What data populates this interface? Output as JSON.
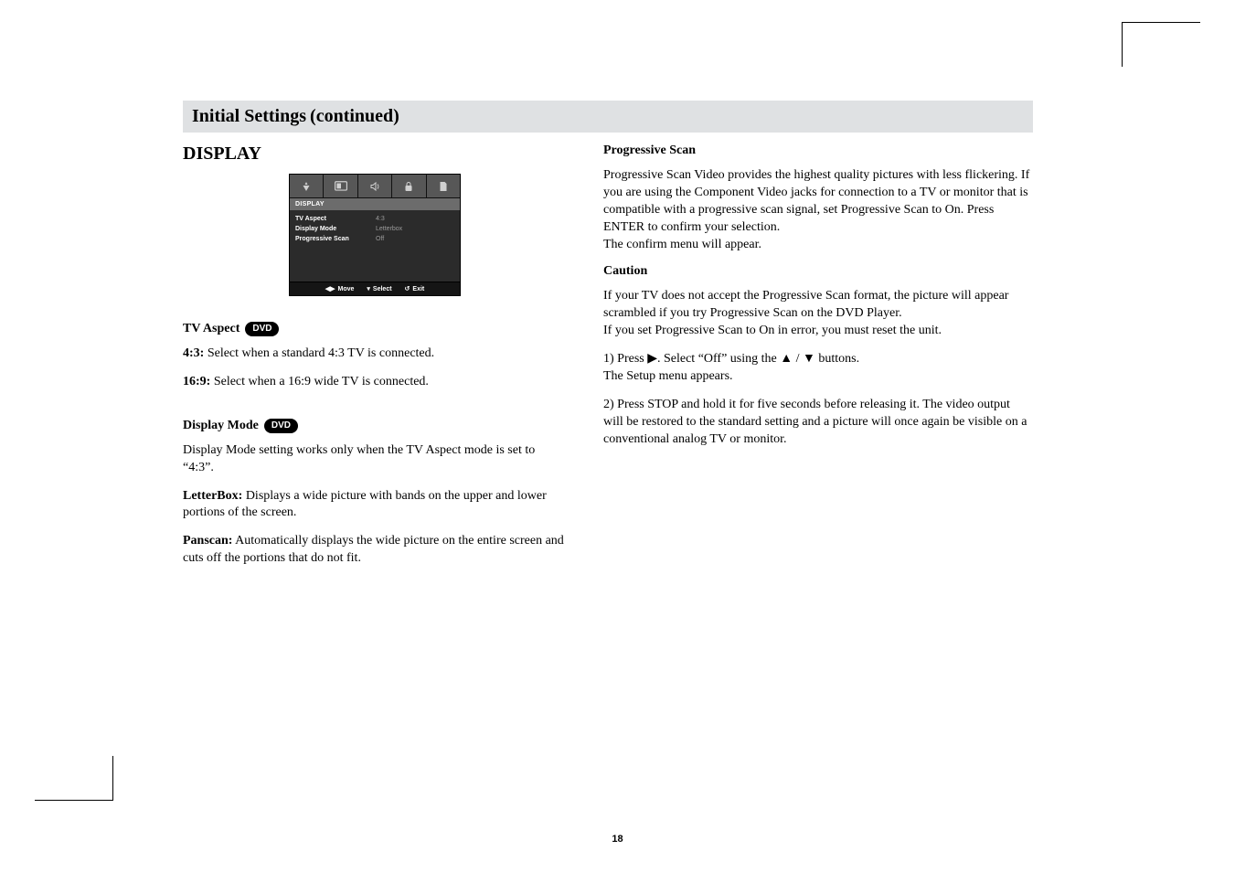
{
  "title": {
    "main": "Initial Settings",
    "suffix": "(continued)"
  },
  "left": {
    "section": "DISPLAY",
    "osd": {
      "header": "DISPLAY",
      "rows": [
        {
          "label": "TV Aspect",
          "value": "4:3"
        },
        {
          "label": "Display Mode",
          "value": "Letterbox"
        },
        {
          "label": "Progressive Scan",
          "value": "Off"
        }
      ],
      "footer": {
        "move": "Move",
        "select": "Select",
        "exit": "Exit"
      }
    },
    "tvAspect": {
      "heading": "TV Aspect",
      "badge": "DVD",
      "p1_lead": "4:3:",
      "p1_rest": " Select when a standard 4:3 TV is connected.",
      "p2_lead": "16:9:",
      "p2_rest": " Select when a 16:9 wide TV is connected."
    },
    "displayMode": {
      "heading": "Display Mode",
      "badge": "DVD",
      "p1": "Display Mode setting works only when the TV Aspect mode is set to “4:3”.",
      "p2_lead": "LetterBox:",
      "p2_rest": " Displays a wide picture with bands on the upper and lower portions of the screen.",
      "p3_lead": "Panscan:",
      "p3_rest": " Automatically displays the wide picture on the entire screen and cuts off the portions that do not fit."
    }
  },
  "right": {
    "ps_heading": "Progressive Scan",
    "ps_body": "Progressive Scan Video provides the highest quality pictures with less flickering. If you are using the Component Video jacks for connection to a TV or monitor that is compatible with a progressive scan signal, set Progressive Scan to On. Press ENTER to confirm your selection.\nThe confirm menu will appear.",
    "caution_heading": "Caution",
    "caution_body": "If your TV does not accept the Progressive Scan format, the picture will appear scrambled if you try Progressive Scan on the DVD Player.\nIf you set Progressive Scan to On in error, you must reset the unit.",
    "step1": "1) Press ▶. Select “Off” using the ▲ / ▼ buttons.\n    The Setup menu appears.",
    "step2": "2) Press STOP and hold it for five seconds before releasing it. The video output will be restored to the standard setting and a picture will once again be visible on a conventional analog TV or monitor."
  },
  "pageNumber": "18"
}
